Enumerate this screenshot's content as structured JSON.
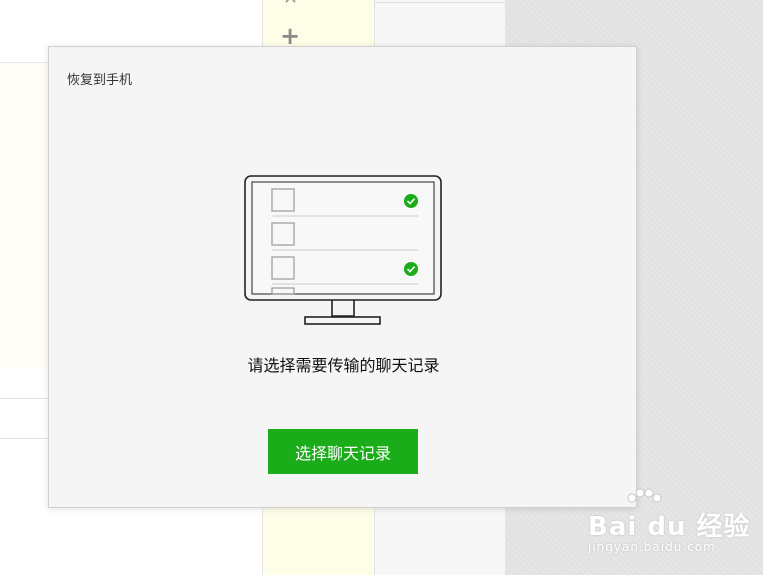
{
  "dialog": {
    "title": "恢复到手机",
    "prompt": "请选择需要传输的聊天记录",
    "primary_button": "选择聊天记录"
  },
  "watermark": {
    "brand": "Bai du 经验",
    "url": "jingyan.baidu.com"
  },
  "icons": {
    "add": "plus-icon",
    "close": "close-icon",
    "monitor": "monitor-illustration-icon",
    "check": "check-circle-icon"
  },
  "colors": {
    "primary_green": "#1aad19",
    "dialog_bg": "#f5f5f5"
  }
}
